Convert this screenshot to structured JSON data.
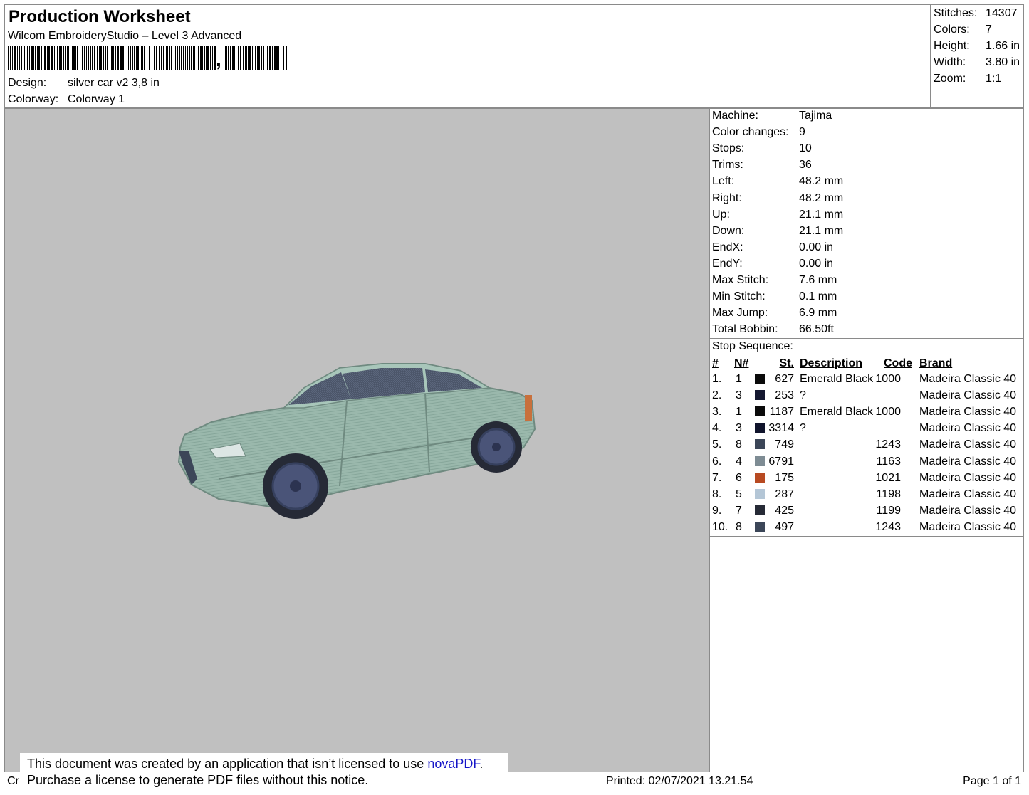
{
  "header": {
    "title": "Production Worksheet",
    "app_name": "Wilcom EmbroideryStudio – Level 3 Advanced",
    "design_label": "Design:",
    "design_value": "silver car v2 3,8 in",
    "colorway_label": "Colorway:",
    "colorway_value": "Colorway 1",
    "barcode_comma": ","
  },
  "summary": [
    {
      "label": "Stitches:",
      "value": "14307"
    },
    {
      "label": "Colors:",
      "value": "7"
    },
    {
      "label": "Height:",
      "value": "1.66 in"
    },
    {
      "label": "Width:",
      "value": "3.80 in"
    },
    {
      "label": "Zoom:",
      "value": "1:1"
    }
  ],
  "machine_info": [
    {
      "label": "Machine:",
      "value": "Tajima"
    },
    {
      "label": "Color changes:",
      "value": "9"
    },
    {
      "label": "Stops:",
      "value": "10"
    },
    {
      "label": "Trims:",
      "value": "36"
    },
    {
      "label": "Left:",
      "value": "48.2 mm"
    },
    {
      "label": "Right:",
      "value": "48.2 mm"
    },
    {
      "label": "Up:",
      "value": "21.1 mm"
    },
    {
      "label": "Down:",
      "value": "21.1 mm"
    },
    {
      "label": "EndX:",
      "value": "0.00 in"
    },
    {
      "label": "EndY:",
      "value": "0.00 in"
    },
    {
      "label": "Max Stitch:",
      "value": "7.6 mm"
    },
    {
      "label": "Min Stitch:",
      "value": "0.1 mm"
    },
    {
      "label": "Max Jump:",
      "value": "6.9 mm"
    },
    {
      "label": "Total Bobbin:",
      "value": "66.50ft"
    }
  ],
  "stop_sequence": {
    "title": "Stop Sequence:",
    "columns": {
      "index": "#",
      "needle": "N#",
      "stitches": "St.",
      "description": "Description",
      "code": "Code",
      "brand": "Brand"
    },
    "rows": [
      {
        "index": "1.",
        "needle": "1",
        "color": "#0a0a0a",
        "stitches": "627",
        "description": "Emerald Black",
        "code": "1000",
        "brand": "Madeira Classic 40"
      },
      {
        "index": "2.",
        "needle": "3",
        "color": "#141830",
        "stitches": "253",
        "description": "?",
        "code": "",
        "brand": "Madeira Classic 40"
      },
      {
        "index": "3.",
        "needle": "1",
        "color": "#0a0a0a",
        "stitches": "1187",
        "description": "Emerald Black",
        "code": "1000",
        "brand": "Madeira Classic 40"
      },
      {
        "index": "4.",
        "needle": "3",
        "color": "#10142c",
        "stitches": "3314",
        "description": "?",
        "code": "",
        "brand": "Madeira Classic 40"
      },
      {
        "index": "5.",
        "needle": "8",
        "color": "#3c4658",
        "stitches": "749",
        "description": "",
        "code": "1243",
        "brand": "Madeira Classic 40"
      },
      {
        "index": "6.",
        "needle": "4",
        "color": "#7e8c94",
        "stitches": "6791",
        "description": "",
        "code": "1163",
        "brand": "Madeira Classic 40"
      },
      {
        "index": "7.",
        "needle": "6",
        "color": "#b84a22",
        "stitches": "175",
        "description": "",
        "code": "1021",
        "brand": "Madeira Classic 40"
      },
      {
        "index": "8.",
        "needle": "5",
        "color": "#b4c6d6",
        "stitches": "287",
        "description": "",
        "code": "1198",
        "brand": "Madeira Classic 40"
      },
      {
        "index": "9.",
        "needle": "7",
        "color": "#262a36",
        "stitches": "425",
        "description": "",
        "code": "1199",
        "brand": "Madeira Classic 40"
      },
      {
        "index": "10.",
        "needle": "8",
        "color": "#3c4658",
        "stitches": "497",
        "description": "",
        "code": "1243",
        "brand": "Madeira Classic 40"
      }
    ]
  },
  "footer": {
    "created_prefix": "Cr",
    "printed": "Printed: 02/07/2021 13.21.54",
    "page": "Page 1 of 1"
  },
  "notice": {
    "line1_text": "This document was created by an application that isn’t licensed to use ",
    "link_text": "novaPDF",
    "line1_end": ".",
    "line2_text": "Purchase a license to generate PDF files without this notice."
  },
  "colors": {
    "preview_background": "#c0c0c0",
    "car_body": "#9ab8ac",
    "link": "#1515c8"
  }
}
